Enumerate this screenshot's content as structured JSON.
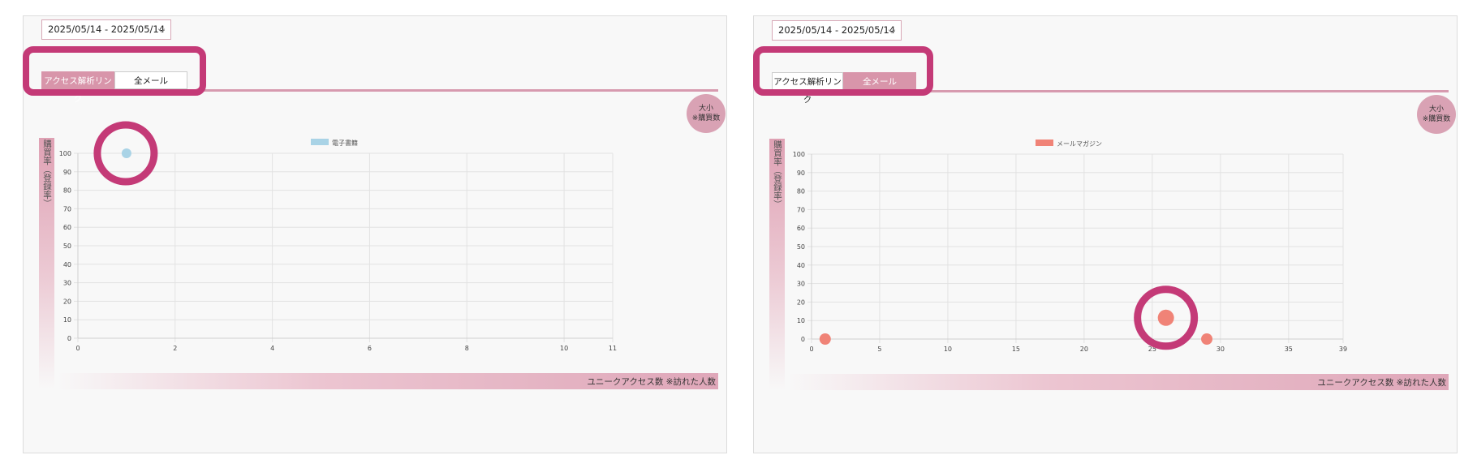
{
  "panels": [
    {
      "date_range": "2025/05/14 - 2025/05/14",
      "tabs": [
        {
          "label": "アクセス解析リンク",
          "active": true
        },
        {
          "label": "全メール",
          "active": false
        }
      ],
      "size_badge": {
        "line1": "大小",
        "line2": "※購買数"
      },
      "y_axis_title": "購買率（登録率）",
      "x_axis_title": "ユニークアクセス数 ※訪れた人数"
    },
    {
      "date_range": "2025/05/14 - 2025/05/14",
      "tabs": [
        {
          "label": "アクセス解析リンク",
          "active": false
        },
        {
          "label": "全メール",
          "active": true
        }
      ],
      "size_badge": {
        "line1": "大小",
        "line2": "※購買数"
      },
      "y_axis_title": "購買率（登録率）",
      "x_axis_title": "ユニークアクセス数 ※訪れた人数"
    }
  ],
  "chart_data": [
    {
      "type": "scatter",
      "legend": "電子書籍",
      "series_color": "#a9d3e6",
      "x_ticks": [
        0,
        2,
        4,
        6,
        8,
        10,
        11
      ],
      "y_ticks": [
        0,
        10,
        20,
        30,
        40,
        50,
        60,
        70,
        80,
        90,
        100
      ],
      "xlim": [
        0,
        11
      ],
      "ylim": [
        0,
        100
      ],
      "points": [
        {
          "x": 1,
          "y": 100,
          "r": 6
        }
      ]
    },
    {
      "type": "scatter",
      "legend": "メールマガジン",
      "series_color": "#f08377",
      "x_ticks": [
        0,
        5,
        10,
        15,
        20,
        25,
        30,
        35,
        39
      ],
      "y_ticks": [
        0,
        10,
        20,
        30,
        40,
        50,
        60,
        70,
        80,
        90,
        100
      ],
      "xlim": [
        0,
        39
      ],
      "ylim": [
        0,
        100
      ],
      "points": [
        {
          "x": 1,
          "y": 0,
          "r": 7
        },
        {
          "x": 26,
          "y": 11.5,
          "r": 10
        },
        {
          "x": 29,
          "y": 0,
          "r": 7
        }
      ]
    }
  ],
  "annotation_color": "#c43a77"
}
